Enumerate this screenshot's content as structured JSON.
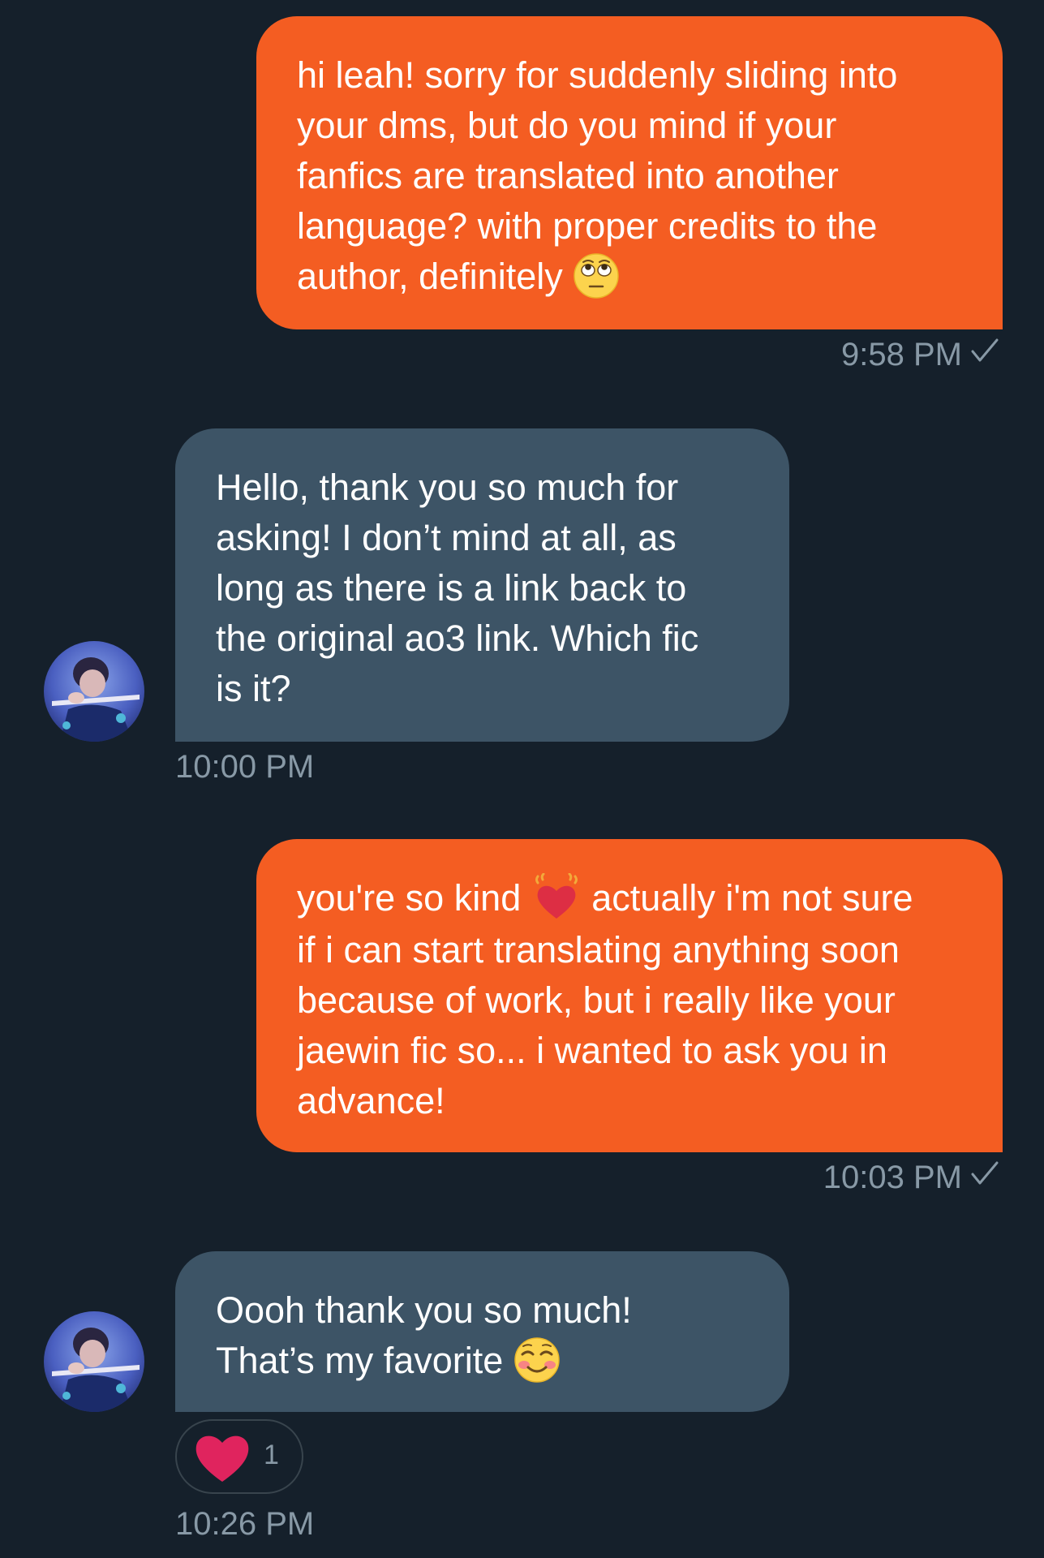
{
  "colors": {
    "background": "#15202b",
    "outgoing_bubble": "#f45d22",
    "incoming_bubble": "#3d5466",
    "timestamp": "#8899a6"
  },
  "messages": [
    {
      "direction": "outgoing",
      "lines": [
        "hi leah! sorry for suddenly sliding into",
        "your dms, but do you mind if your",
        "fanfics are translated into another",
        "language? with proper credits to the",
        "author, definitely"
      ],
      "emoji": "face-with-rolling-eyes-icon",
      "time": "9:58 PM",
      "status": "sent-check-icon"
    },
    {
      "direction": "incoming",
      "lines": [
        "Hello, thank you so much for",
        "asking! I don’t mind at all, as",
        "long as there is a link back to",
        "the original ao3 link. Which fic",
        "is it?"
      ],
      "time": "10:00 PM"
    },
    {
      "direction": "outgoing",
      "lines_first_before_emoji": "you're so kind",
      "lines_first_after_emoji": "actually i'm not sure",
      "lines": [
        "if i can start translating anything soon",
        "because of work, but i really like your",
        "jaewin fic so... i wanted to ask you in",
        "advance!"
      ],
      "emoji": "beating-heart-icon",
      "time": "10:03 PM",
      "status": "sent-check-icon"
    },
    {
      "direction": "incoming",
      "lines": [
        "Oooh thank you so much!",
        "That’s my favorite"
      ],
      "emoji": "smiling-face-icon",
      "reaction": {
        "icon": "red-heart-icon",
        "count": "1"
      },
      "time": "10:26 PM"
    }
  ]
}
